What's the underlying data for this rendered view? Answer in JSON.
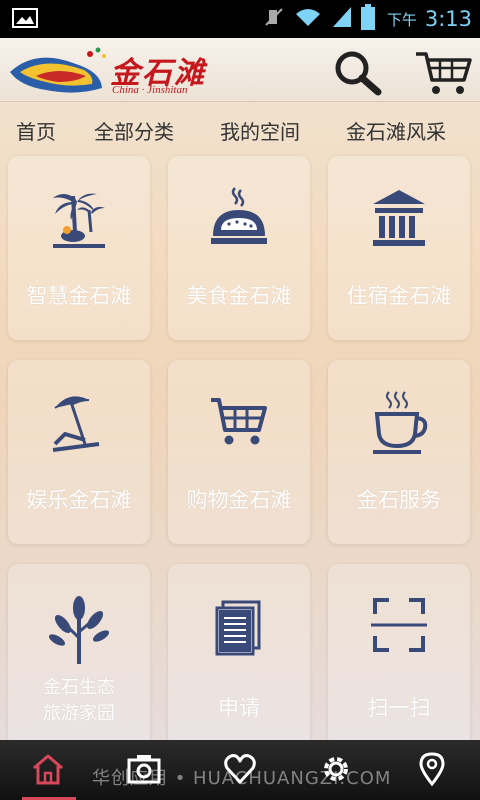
{
  "status_bar": {
    "ampm": "下午",
    "time": "3:13"
  },
  "header": {
    "logo_cn": "金石滩",
    "logo_en": "China · Jinshitan",
    "search_icon": "search-icon",
    "cart_icon": "cart-icon"
  },
  "nav": {
    "tabs": [
      "首页",
      "全部分类",
      "我的空间",
      "金石滩风采"
    ]
  },
  "tiles": [
    {
      "label": "智慧金石滩",
      "icon": "palm-island-icon"
    },
    {
      "label": "美食金石滩",
      "icon": "bread-icon"
    },
    {
      "label": "住宿金石滩",
      "icon": "building-icon"
    },
    {
      "label": "娱乐金石滩",
      "icon": "beach-umbrella-icon"
    },
    {
      "label": "购物金石滩",
      "icon": "shopping-cart-icon"
    },
    {
      "label": "金石服务",
      "icon": "coffee-cup-icon"
    },
    {
      "label_line1": "金石生态",
      "label_line2": "旅游家园",
      "icon": "tree-icon"
    },
    {
      "label": "申请",
      "icon": "document-icon"
    },
    {
      "label": "扫一扫",
      "icon": "scan-icon"
    }
  ],
  "bottom_bar": {
    "items": [
      "home-icon",
      "camera-icon",
      "heart-icon",
      "settings-icon",
      "location-icon"
    ],
    "watermark": "华创应用 • HUACHUANGZI.COM"
  },
  "colors": {
    "accent": "#d8485a",
    "icon": "#3a4a78",
    "brand_red": "#c6171d",
    "time": "#7fd3f7"
  }
}
